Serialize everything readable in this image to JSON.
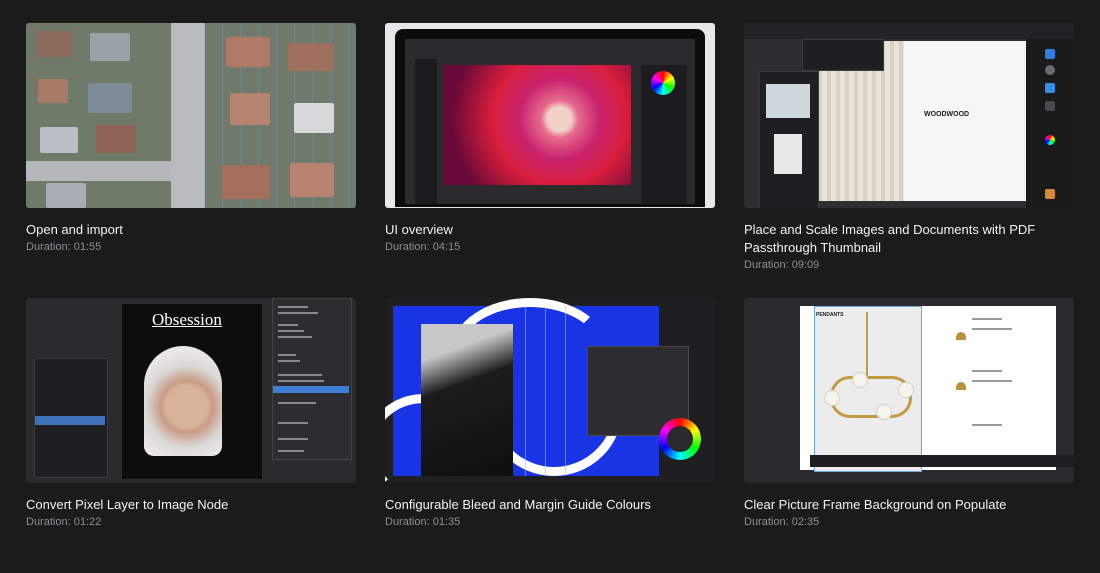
{
  "duration_label": "Duration:",
  "videos": [
    {
      "title": "Open and import",
      "duration": "01:55"
    },
    {
      "title": "UI overview",
      "duration": "04:15"
    },
    {
      "title": "Place and Scale Images and Documents with PDF Passthrough Thumbnail",
      "duration": "09:09"
    },
    {
      "title": "Convert Pixel Layer to Image Node",
      "duration": "01:22"
    },
    {
      "title": "Configurable Bleed and Margin Guide Colours",
      "duration": "01:35"
    },
    {
      "title": "Clear Picture Frame Background on Populate",
      "duration": "02:35"
    }
  ],
  "thumbnail_text": {
    "woodwood": "WOODWOOD",
    "obsession": "Obsession",
    "pendants": "PENDANTS"
  }
}
